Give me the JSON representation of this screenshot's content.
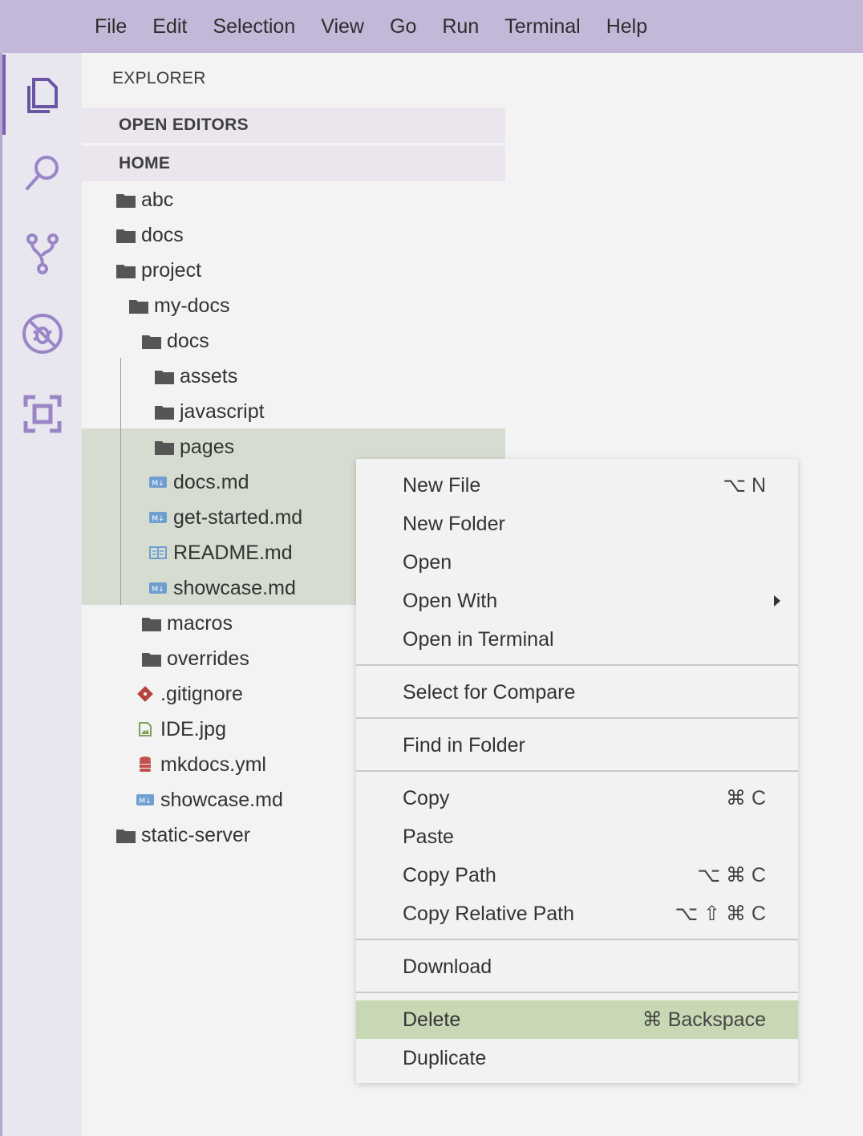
{
  "menu": [
    "File",
    "Edit",
    "Selection",
    "View",
    "Go",
    "Run",
    "Terminal",
    "Help"
  ],
  "activity": [
    "explorer-icon",
    "search-icon",
    "source-control-icon",
    "debug-icon",
    "extensions-icon"
  ],
  "sidebar": {
    "title": "EXPLORER",
    "open_editors": "OPEN EDITORS",
    "home": "HOME",
    "tree": [
      {
        "label": "abc",
        "icon": "folder-icon"
      },
      {
        "label": "docs",
        "icon": "folder-icon"
      },
      {
        "label": "project",
        "icon": "folder-icon"
      },
      {
        "label": "my-docs",
        "icon": "folder-icon"
      },
      {
        "label": "docs",
        "icon": "folder-icon"
      },
      {
        "label": "assets",
        "icon": "folder-icon"
      },
      {
        "label": "javascript",
        "icon": "folder-icon"
      },
      {
        "label": "pages",
        "icon": "folder-icon"
      },
      {
        "label": "docs.md",
        "icon": "markdown-icon"
      },
      {
        "label": "get-started.md",
        "icon": "markdown-icon"
      },
      {
        "label": "README.md",
        "icon": "readme-icon"
      },
      {
        "label": "showcase.md",
        "icon": "markdown-icon"
      },
      {
        "label": "macros",
        "icon": "folder-icon"
      },
      {
        "label": "overrides",
        "icon": "folder-icon"
      },
      {
        "label": ".gitignore",
        "icon": "git-icon"
      },
      {
        "label": "IDE.jpg",
        "icon": "image-icon"
      },
      {
        "label": "mkdocs.yml",
        "icon": "yaml-icon"
      },
      {
        "label": "showcase.md",
        "icon": "markdown-icon"
      },
      {
        "label": "static-server",
        "icon": "folder-icon"
      }
    ]
  },
  "context_menu": {
    "items": [
      {
        "label": "New File",
        "shortcut": "⌥ N"
      },
      {
        "label": "New Folder",
        "shortcut": ""
      },
      {
        "label": "Open",
        "shortcut": ""
      },
      {
        "label": "Open With",
        "shortcut": ""
      },
      {
        "label": "Open in Terminal",
        "shortcut": ""
      },
      {
        "label": "Select for Compare",
        "shortcut": ""
      },
      {
        "label": "Find in Folder",
        "shortcut": ""
      },
      {
        "label": "Copy",
        "shortcut": "⌘ C"
      },
      {
        "label": "Paste",
        "shortcut": ""
      },
      {
        "label": "Copy Path",
        "shortcut": "⌥ ⌘ C"
      },
      {
        "label": "Copy Relative Path",
        "shortcut": "⌥ ⇧ ⌘ C"
      },
      {
        "label": "Download",
        "shortcut": ""
      },
      {
        "label": "Delete",
        "shortcut": "⌘ Backspace"
      },
      {
        "label": "Duplicate",
        "shortcut": ""
      }
    ]
  },
  "colors": {
    "menubar": "#c3b8d8",
    "activity_bar": "#e8e6ef",
    "selection": "#d6dcd0",
    "menu_highlight": "#c9d8b4",
    "accent": "#7a5fb5"
  }
}
